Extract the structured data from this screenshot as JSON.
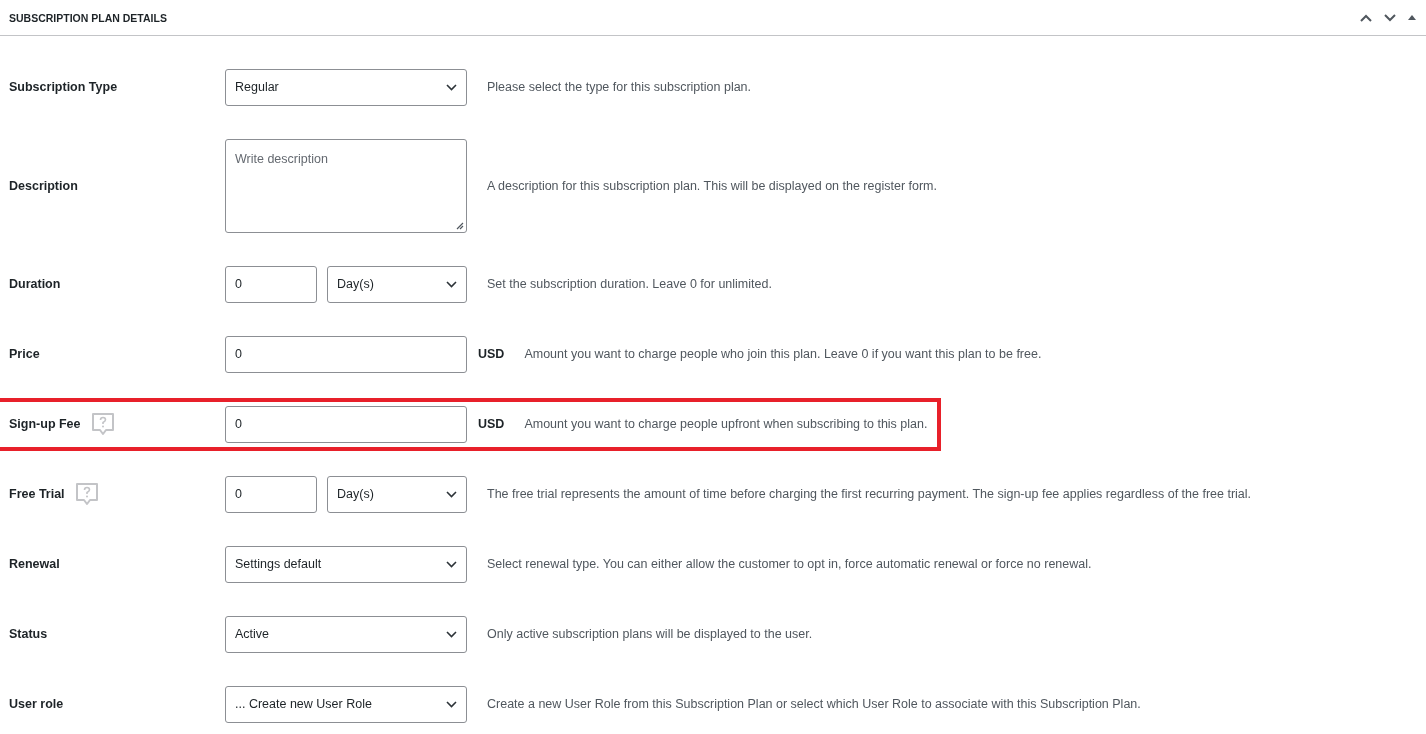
{
  "panel": {
    "title": "SUBSCRIPTION PLAN DETAILS"
  },
  "fields": [
    {
      "label": "Subscription Type",
      "help_icon": false,
      "highlighted": false,
      "controls": [
        {
          "kind": "select",
          "value": "Regular"
        }
      ],
      "description": "Please select the type for this subscription plan."
    },
    {
      "label": "Description",
      "help_icon": false,
      "highlighted": false,
      "controls": [
        {
          "kind": "textarea",
          "placeholder": "Write description"
        }
      ],
      "description": "A description for this subscription plan. This will be displayed on the register form."
    },
    {
      "label": "Duration",
      "help_icon": false,
      "highlighted": false,
      "controls": [
        {
          "kind": "number",
          "value": "0"
        },
        {
          "kind": "select",
          "value": "Day(s)"
        }
      ],
      "description": "Set the subscription duration. Leave 0 for unlimited."
    },
    {
      "label": "Price",
      "help_icon": false,
      "highlighted": false,
      "controls": [
        {
          "kind": "text",
          "value": "0"
        }
      ],
      "unit": "USD",
      "description": "Amount you want to charge people who join this plan. Leave 0 if you want this plan to be free."
    },
    {
      "label": "Sign-up Fee",
      "help_icon": true,
      "highlighted": true,
      "controls": [
        {
          "kind": "text",
          "value": "0"
        }
      ],
      "unit": "USD",
      "description": "Amount you want to charge people upfront when subscribing to this plan."
    },
    {
      "label": "Free Trial",
      "help_icon": true,
      "highlighted": false,
      "controls": [
        {
          "kind": "number",
          "value": "0"
        },
        {
          "kind": "select",
          "value": "Day(s)"
        }
      ],
      "description": "The free trial represents the amount of time before charging the first recurring payment. The sign-up fee applies regardless of the free trial."
    },
    {
      "label": "Renewal",
      "help_icon": false,
      "highlighted": false,
      "controls": [
        {
          "kind": "select",
          "value": "Settings default"
        }
      ],
      "description": "Select renewal type. You can either allow the customer to opt in, force automatic renewal or force no renewal."
    },
    {
      "label": "Status",
      "help_icon": false,
      "highlighted": false,
      "controls": [
        {
          "kind": "select",
          "value": "Active"
        }
      ],
      "description": "Only active subscription plans will be displayed to the user."
    },
    {
      "label": "User role",
      "help_icon": false,
      "highlighted": false,
      "controls": [
        {
          "kind": "select",
          "value": "... Create new User Role"
        }
      ],
      "description": "Create a new User Role from this Subscription Plan or select which User Role to associate with this Subscription Plan."
    }
  ]
}
